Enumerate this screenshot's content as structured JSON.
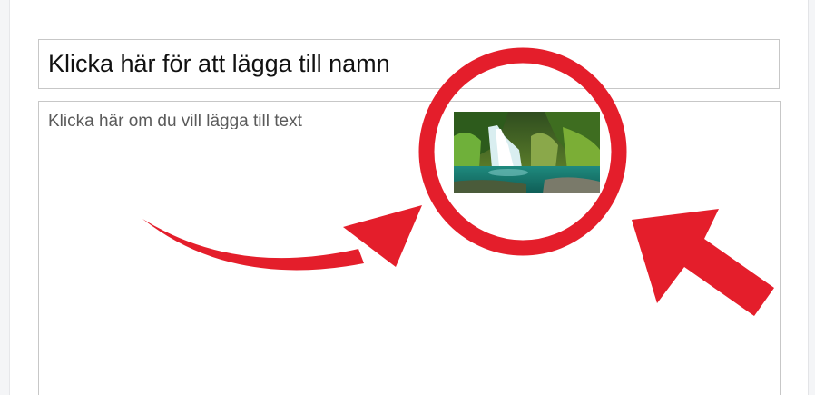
{
  "editor": {
    "name_placeholder": "Klicka här för att lägga till namn",
    "text_placeholder": "Klicka här om du vill lägga till text"
  },
  "annotation": {
    "highlight_color": "#e41e2b",
    "picture": "waterfall-image"
  }
}
